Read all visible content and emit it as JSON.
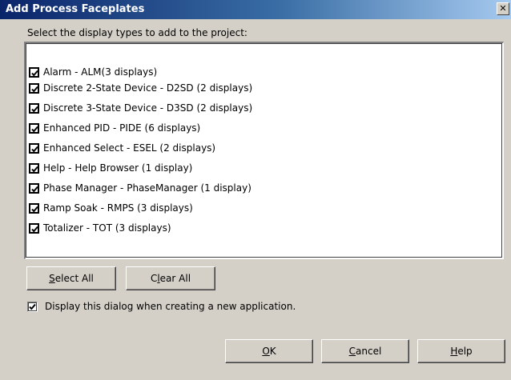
{
  "window": {
    "title": "Add Process Faceplates",
    "close_glyph": "✕"
  },
  "prompt": "Select the display types to add to the project:",
  "display_types": [
    {
      "label": "Alarm - ALM(3 displays)",
      "checked": true
    },
    {
      "label": "Discrete 2-State Device - D2SD (2 displays)",
      "checked": true
    },
    {
      "label": "Discrete 3-State Device - D3SD (2 displays)",
      "checked": true
    },
    {
      "label": "Enhanced PID - PIDE (6 displays)",
      "checked": true
    },
    {
      "label": "Enhanced Select - ESEL (2 displays)",
      "checked": true
    },
    {
      "label": "Help - Help Browser (1 display)",
      "checked": true
    },
    {
      "label": "Phase Manager - PhaseManager (1 display)",
      "checked": true
    },
    {
      "label": "Ramp Soak - RMPS (3 displays)",
      "checked": true
    },
    {
      "label": "Totalizer - TOT (3 displays)",
      "checked": true
    }
  ],
  "buttons": {
    "select_all": {
      "mnemonic": "S",
      "rest": "elect All"
    },
    "clear_all": {
      "pre": "C",
      "mnemonic": "l",
      "rest": "ear All"
    },
    "ok": {
      "mnemonic": "O",
      "rest": "K"
    },
    "cancel": {
      "mnemonic": "C",
      "rest": "ancel"
    },
    "help": {
      "mnemonic": "H",
      "rest": "elp"
    }
  },
  "option": {
    "label": "Display this dialog when creating a new application.",
    "checked": true
  }
}
